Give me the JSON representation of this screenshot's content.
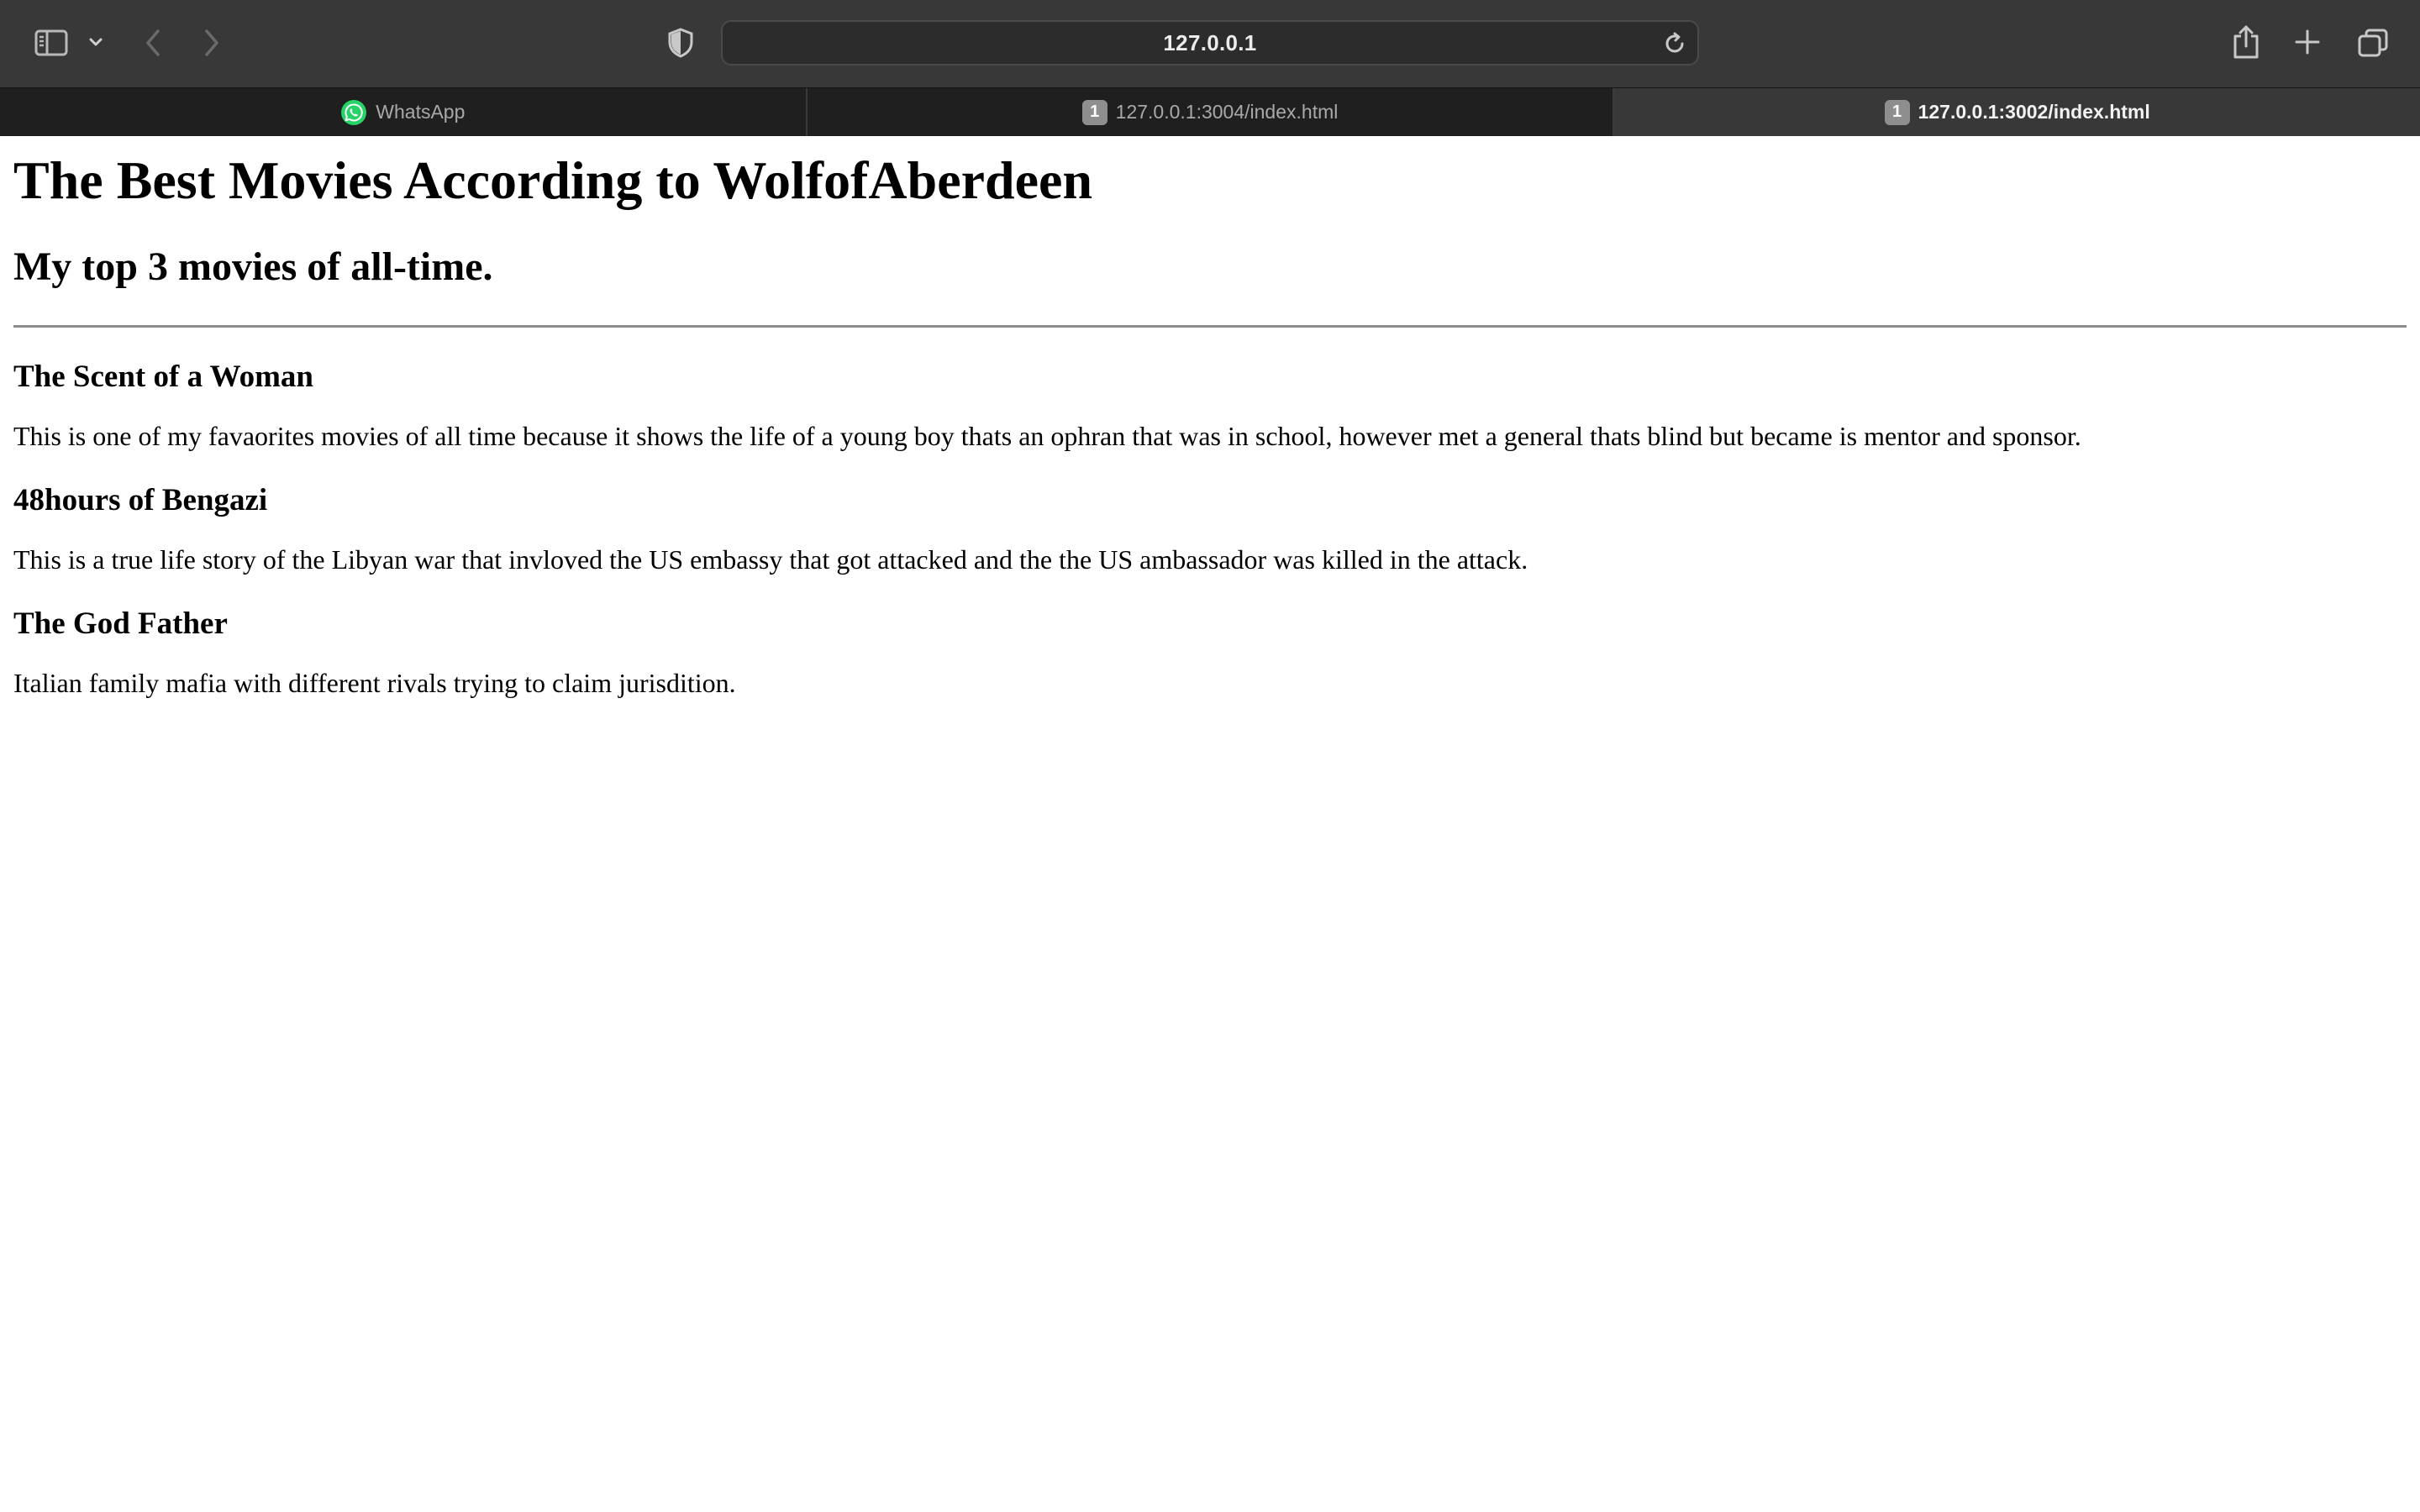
{
  "browser": {
    "address_bar": {
      "url": "127.0.0.1"
    },
    "tabs": [
      {
        "label": "WhatsApp",
        "icon": "whatsapp-icon",
        "active": false
      },
      {
        "label": "127.0.0.1:3004/index.html",
        "badge": "1",
        "active": false
      },
      {
        "label": "127.0.0.1:3002/index.html",
        "badge": "1",
        "active": true
      }
    ]
  },
  "page": {
    "title": "The Best Movies According to WolfofAberdeen",
    "subtitle": "My top 3 movies of all-time.",
    "movies": [
      {
        "name": "The Scent of a Woman",
        "description": "This is one of my favaorites movies of all time because it shows the life of a young boy thats an ophran that was in school, however met a general thats blind but became is mentor and sponsor."
      },
      {
        "name": "48hours of Bengazi",
        "description": "This is a true life story of the Libyan war that invloved the US embassy that got attacked and the the US ambassador was killed in the attack."
      },
      {
        "name": "The God Father",
        "description": "Italian family mafia with different rivals trying to claim jurisdition."
      }
    ]
  },
  "colors": {
    "toolbar_bg": "#383838",
    "tabbar_bg": "#1f1f1f",
    "whatsapp_green": "#25D366"
  }
}
